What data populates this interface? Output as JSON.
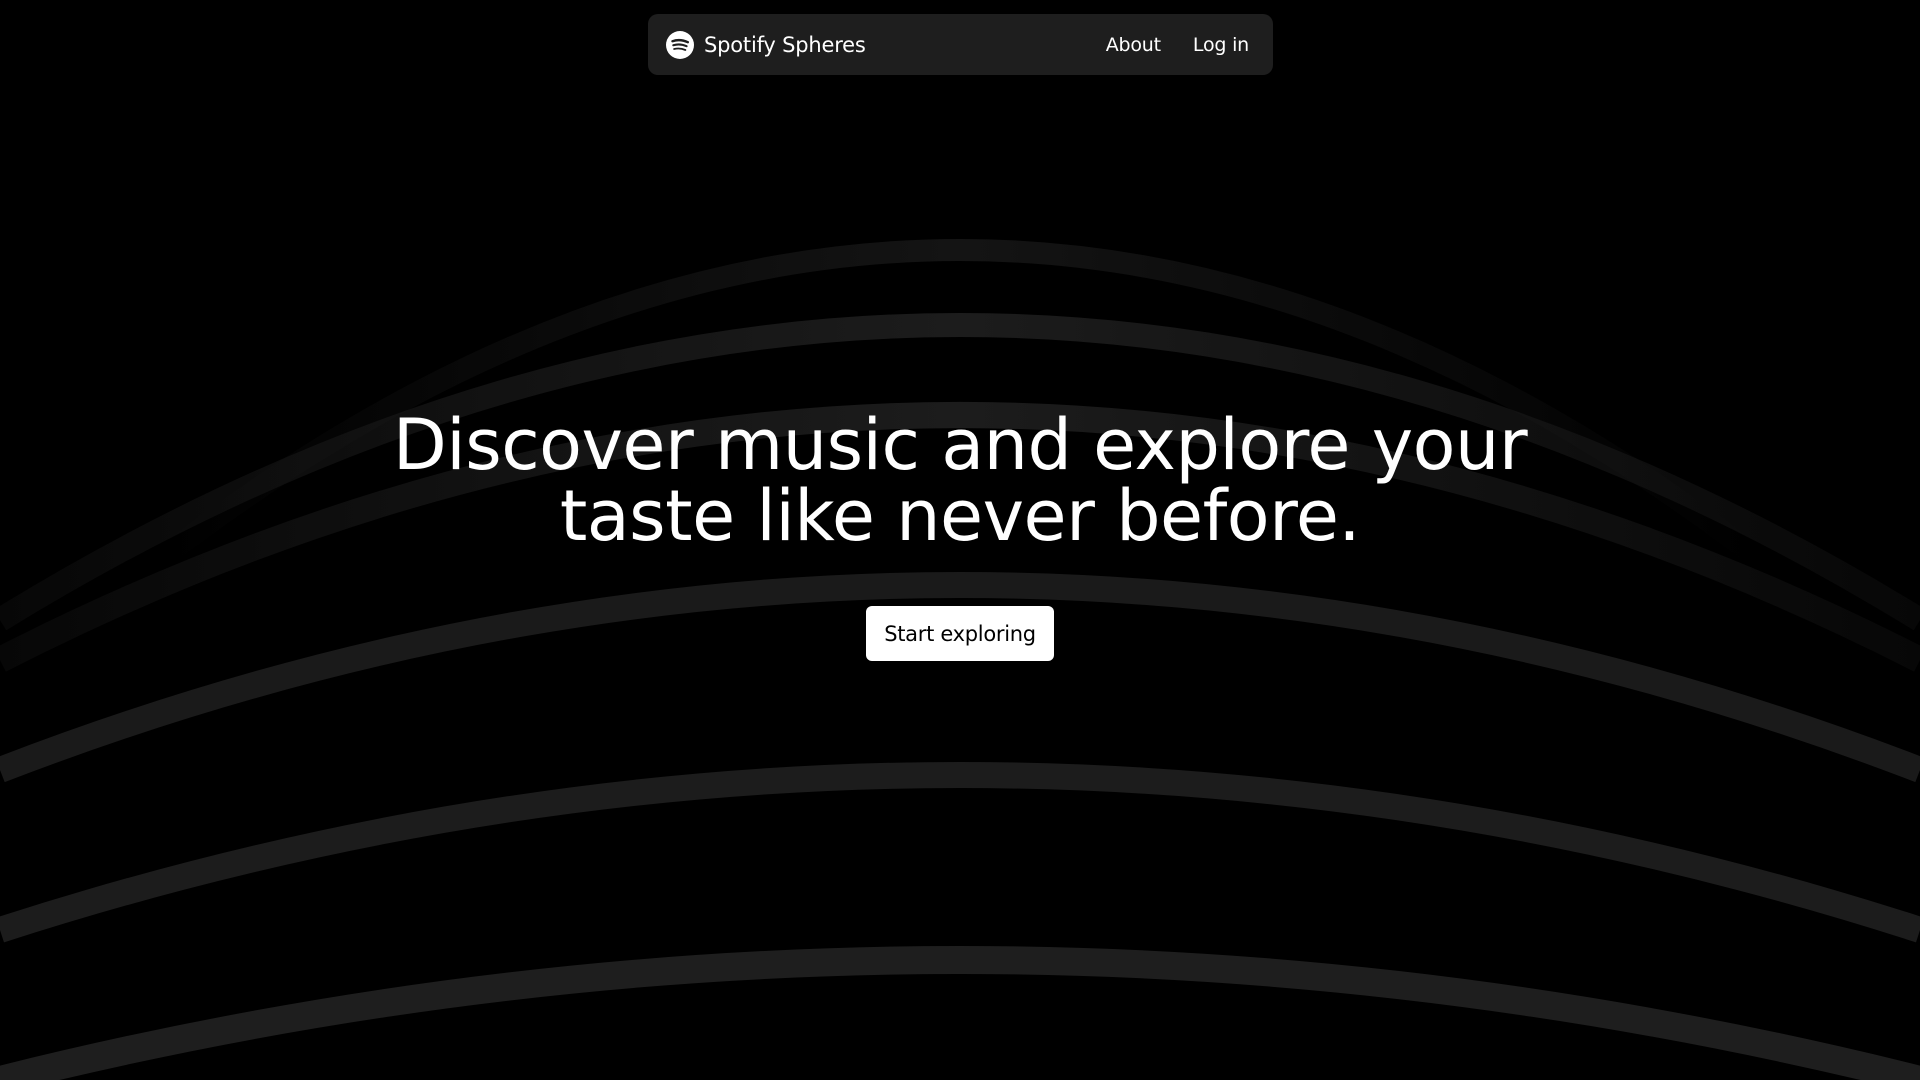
{
  "nav": {
    "brand_name": "Spotify Spheres",
    "brand_icon": "spotify-logo-icon",
    "links": [
      {
        "label": "About"
      },
      {
        "label": "Log in"
      }
    ]
  },
  "hero": {
    "title_line_1": "Discover music and explore your",
    "title_line_2": "taste like never before.",
    "cta_label": "Start exploring"
  },
  "colors": {
    "background": "#000000",
    "navbar": "#1e1e1e",
    "arc": "#1c1c1c",
    "text": "#ffffff",
    "button_bg": "#ffffff",
    "button_text": "#000000"
  }
}
